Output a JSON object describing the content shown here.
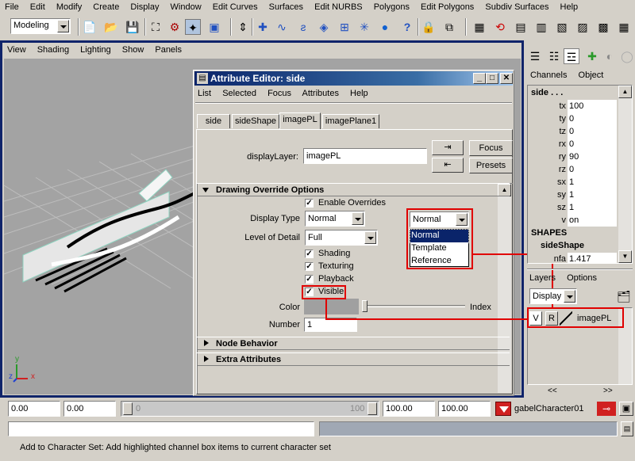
{
  "menubar": [
    "File",
    "Edit",
    "Modify",
    "Create",
    "Display",
    "Window",
    "Edit Curves",
    "Surfaces",
    "Edit NURBS",
    "Polygons",
    "Edit Polygons",
    "Subdiv Surfaces",
    "Help"
  ],
  "toolbar": {
    "mode": "Modeling"
  },
  "viewport": {
    "menus": [
      "View",
      "Shading",
      "Lighting",
      "Show",
      "Panels"
    ],
    "axis_y": "y",
    "axis_z": "z",
    "axis_x": "x"
  },
  "attr": {
    "title": "Attribute Editor: side",
    "menus": [
      "List",
      "Selected",
      "Focus",
      "Attributes",
      "Help"
    ],
    "tabs": [
      "side",
      "sideShape",
      "imagePL",
      "imagePlane1"
    ],
    "display_layer_label": "displayLayer:",
    "display_layer_value": "imagePL",
    "focus_label": "Focus",
    "presets_label": "Presets",
    "drawing_override": {
      "header": "Drawing Override Options",
      "enable_overrides": "Enable Overrides",
      "display_type_label": "Display Type",
      "display_type_value": "Normal",
      "level_of_detail_label": "Level of Detail",
      "level_of_detail_value": "Full",
      "shading": "Shading",
      "texturing": "Texturing",
      "playback": "Playback",
      "visible": "Visible",
      "color_label": "Color",
      "index_label": "Index",
      "number_label": "Number",
      "number_value": "1"
    },
    "node_behavior": "Node Behavior",
    "extra_attributes": "Extra Attributes"
  },
  "popup": {
    "selected": "Normal",
    "options": [
      "Normal",
      "Template",
      "Reference"
    ]
  },
  "channels": {
    "menus": [
      "Channels",
      "Object"
    ],
    "node": "side . . .",
    "rows": [
      {
        "name": "tx",
        "value": "100"
      },
      {
        "name": "ty",
        "value": "0"
      },
      {
        "name": "tz",
        "value": "0"
      },
      {
        "name": "rx",
        "value": "0"
      },
      {
        "name": "ry",
        "value": "90"
      },
      {
        "name": "rz",
        "value": "0"
      },
      {
        "name": "sx",
        "value": "1"
      },
      {
        "name": "sy",
        "value": "1"
      },
      {
        "name": "sz",
        "value": "1"
      },
      {
        "name": "v",
        "value": "on"
      }
    ],
    "shapes_header": "SHAPES",
    "shape_name": "sideShape",
    "shape_attr_name": "nfa",
    "shape_attr_value": "1.417"
  },
  "layers": {
    "menus": [
      "Layers",
      "Options"
    ],
    "mode": "Display",
    "row": {
      "v": "V",
      "r": "R",
      "name": "imagePL"
    },
    "nav_prev": "<<",
    "nav_next": ">>"
  },
  "timeline": {
    "start": "0.00",
    "current": "0.00",
    "range_start": "0",
    "range_end": "100",
    "end1": "100.00",
    "end2": "100.00",
    "character": "gabelCharacter01"
  },
  "help_line": "Add to Character Set: Add highlighted channel box items to current character set"
}
